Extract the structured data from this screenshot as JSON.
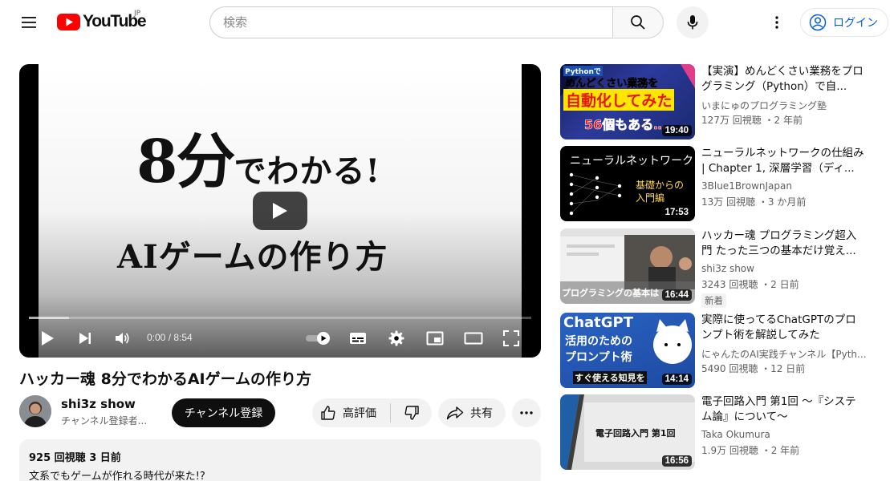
{
  "header": {
    "logo_text": "YouTube",
    "country": "JP",
    "search_placeholder": "検索",
    "signin_label": "ログイン"
  },
  "player": {
    "thumbnail_line1_big": "8分",
    "thumbnail_line1_rest": "でわかる!",
    "thumbnail_line2": "AIゲームの作り方",
    "time": "0:00 / 8:54",
    "loaded_fraction": 0.08
  },
  "video": {
    "title": "ハッカー魂 8分でわかるAIゲームの作り方",
    "channel": "shi3z show",
    "subscribers": "チャンネル登録者...",
    "subscribe_label": "チャンネル登録",
    "like_label": "高評価",
    "share_label": "共有",
    "description_stats": "925 回視聴  3 日前",
    "description_text": "文系でもゲームが作れる時代が来た!?"
  },
  "recommendations": [
    {
      "title": "【実演】めんどくさい業務をプログラミング（Python）で自...",
      "channel": "いまにゅのプログラミング塾",
      "meta": "127万 回視聴 ・2 年前",
      "duration": "19:40",
      "thumb_texts": [
        "Pythonで",
        "めんどくさい業務を",
        "自動化してみた",
        "56個もある…"
      ]
    },
    {
      "title": "ニューラルネットワークの仕組み | Chapter 1, 深層学習（ディ...",
      "channel": "3Blue1BrownJapan",
      "meta": "13万 回視聴 ・3 か月前",
      "duration": "17:53",
      "thumb_texts": [
        "ニューラルネットワーク",
        "基礎からの",
        "入門編"
      ]
    },
    {
      "title": "ハッカー魂 プログラミング超入門 たった三つの基本だけ覚え...",
      "channel": "shi3z show",
      "meta": "3243 回視聴 ・2 日前",
      "badge": "新着",
      "duration": "16:44",
      "thumb_texts": [
        "プログラミングの基本は"
      ]
    },
    {
      "title": "実際に使ってるChatGPTのプロンプト術を解説してみた",
      "channel": "にゃんたのAI実践チャンネル【Pyth...",
      "meta": "5490 回視聴 ・12 日前",
      "duration": "14:14",
      "thumb_texts": [
        "ChatGPT",
        "活用のための",
        "プロンプト術",
        "すぐ使える知見を"
      ]
    },
    {
      "title": "電子回路入門 第1回 〜『システム論』について〜",
      "channel": "Taka Okumura",
      "meta": "1.9万 回視聴 ・2 年前",
      "duration": "16:56",
      "thumb_texts": [
        "電子回路入門 第1回"
      ]
    }
  ],
  "colors": {
    "brand_red": "#ff0000",
    "link_blue": "#065fd4"
  }
}
